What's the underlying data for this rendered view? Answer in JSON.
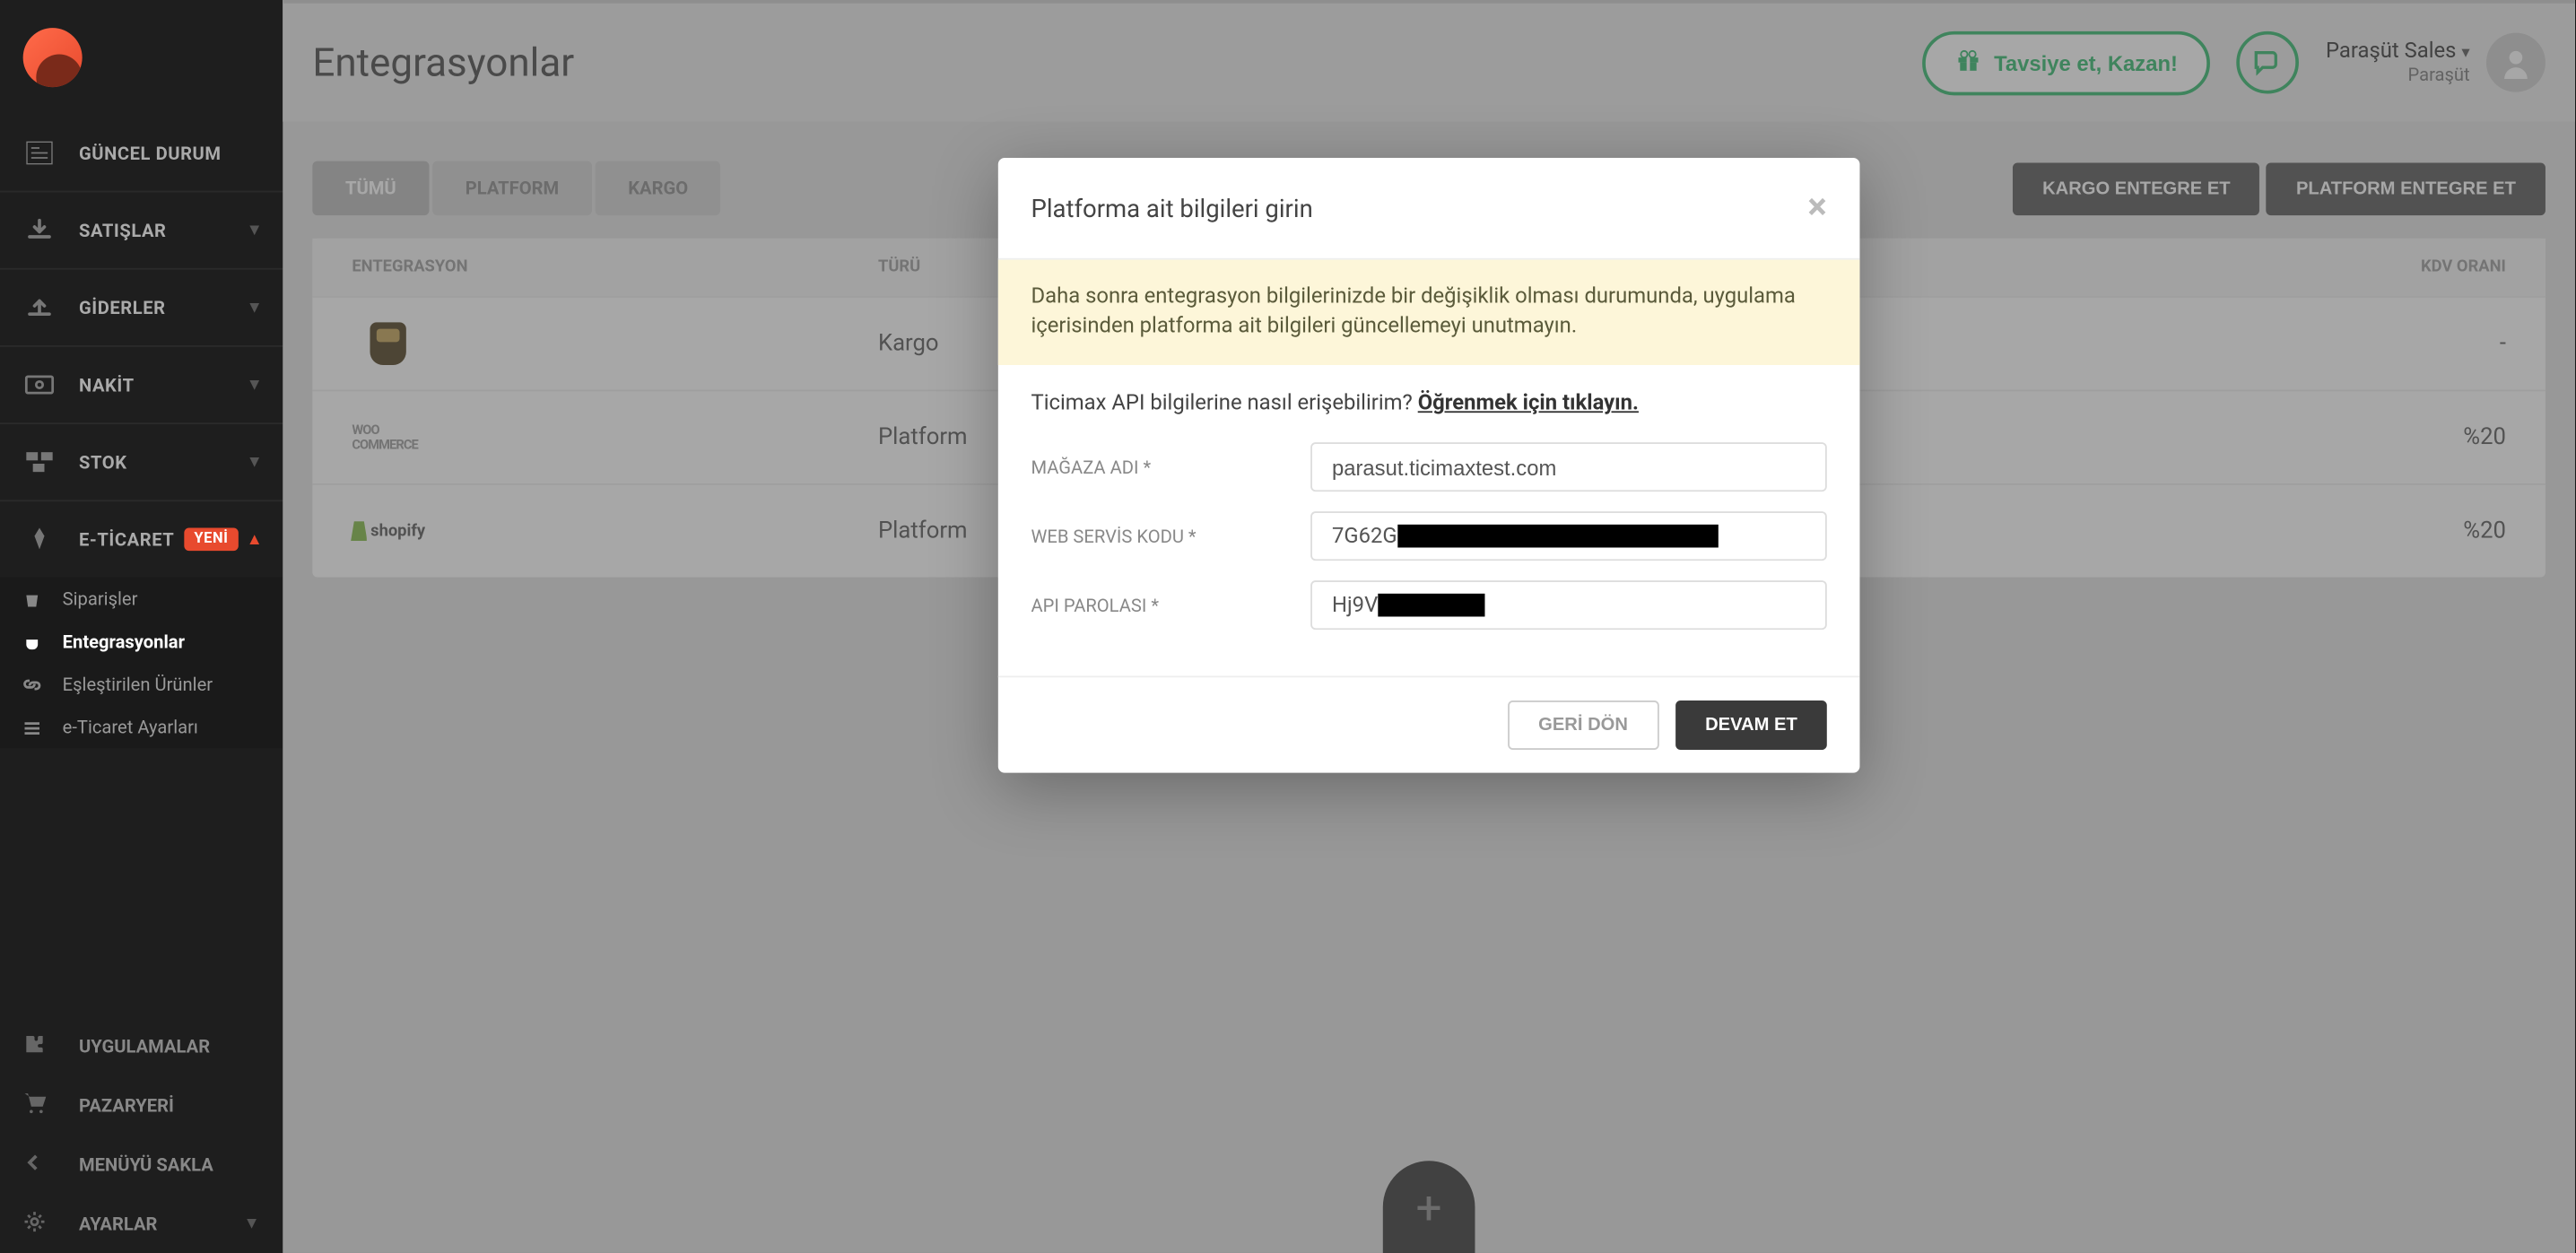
{
  "sidebar": {
    "items": [
      {
        "label": "GÜNCEL DURUM",
        "icon": "newspaper"
      },
      {
        "label": "SATIŞLAR",
        "icon": "download",
        "expandable": true
      },
      {
        "label": "GİDERLER",
        "icon": "upload",
        "expandable": true
      },
      {
        "label": "NAKİT",
        "icon": "cash",
        "expandable": true
      },
      {
        "label": "STOK",
        "icon": "boxes",
        "expandable": true
      },
      {
        "label": "E-TİCARET",
        "icon": "rocket",
        "badge": "YENİ",
        "open": true
      }
    ],
    "ecommerce_sub": [
      {
        "label": "Siparişler",
        "icon": "bag"
      },
      {
        "label": "Entegrasyonlar",
        "icon": "plug",
        "active": true
      },
      {
        "label": "Eşleştirilen Ürünler",
        "icon": "link"
      },
      {
        "label": "e-Ticaret Ayarları",
        "icon": "sliders"
      }
    ],
    "bottom": [
      {
        "label": "UYGULAMALAR",
        "icon": "puzzle"
      },
      {
        "label": "PAZARYERİ",
        "icon": "cart"
      },
      {
        "label": "MENÜYÜ SAKLA",
        "icon": "collapse"
      },
      {
        "label": "AYARLAR",
        "icon": "gear",
        "expandable": true
      }
    ]
  },
  "header": {
    "title": "Entegrasyonlar",
    "recommend": "Tavsiye et, Kazan!",
    "user_name": "Paraşüt Sales",
    "user_company": "Paraşüt"
  },
  "toolbar": {
    "tabs": [
      {
        "label": "TÜMÜ",
        "active": true
      },
      {
        "label": "PLATFORM"
      },
      {
        "label": "KARGO"
      }
    ],
    "actions": {
      "cargo": "KARGO ENTEGRE ET",
      "platform": "PLATFORM ENTEGRE ET"
    }
  },
  "table": {
    "headers": {
      "integration": "ENTEGRASYON",
      "type": "TÜRÜ",
      "kdv": "KDV ORANI"
    },
    "rows": [
      {
        "logo": "ups",
        "type": "Kargo",
        "kdv": "-"
      },
      {
        "logo": "woo",
        "type": "Platform",
        "kdv": "%20"
      },
      {
        "logo": "shopify",
        "type": "Platform",
        "kdv": "%20"
      }
    ]
  },
  "modal": {
    "title": "Platforma ait bilgileri girin",
    "alert": "Daha sonra entegrasyon bilgilerinizde bir değişiklik olması durumunda, uygulama içerisinden platforma ait bilgileri güncellemeyi unutmayın.",
    "help_prefix": "Ticimax API bilgilerine nasıl erişebilirim? ",
    "help_link": "Öğrenmek için tıklayın.",
    "fields": {
      "store_label": "MAĞAZA ADI *",
      "store_value": "parasut.ticimaxtest.com",
      "service_label": "WEB SERVİS KODU *",
      "service_value_prefix": "7G62G",
      "api_label": "API PAROLASI *",
      "api_value_prefix": "Hj9V"
    },
    "buttons": {
      "back": "GERİ DÖN",
      "continue": "DEVAM ET"
    }
  }
}
